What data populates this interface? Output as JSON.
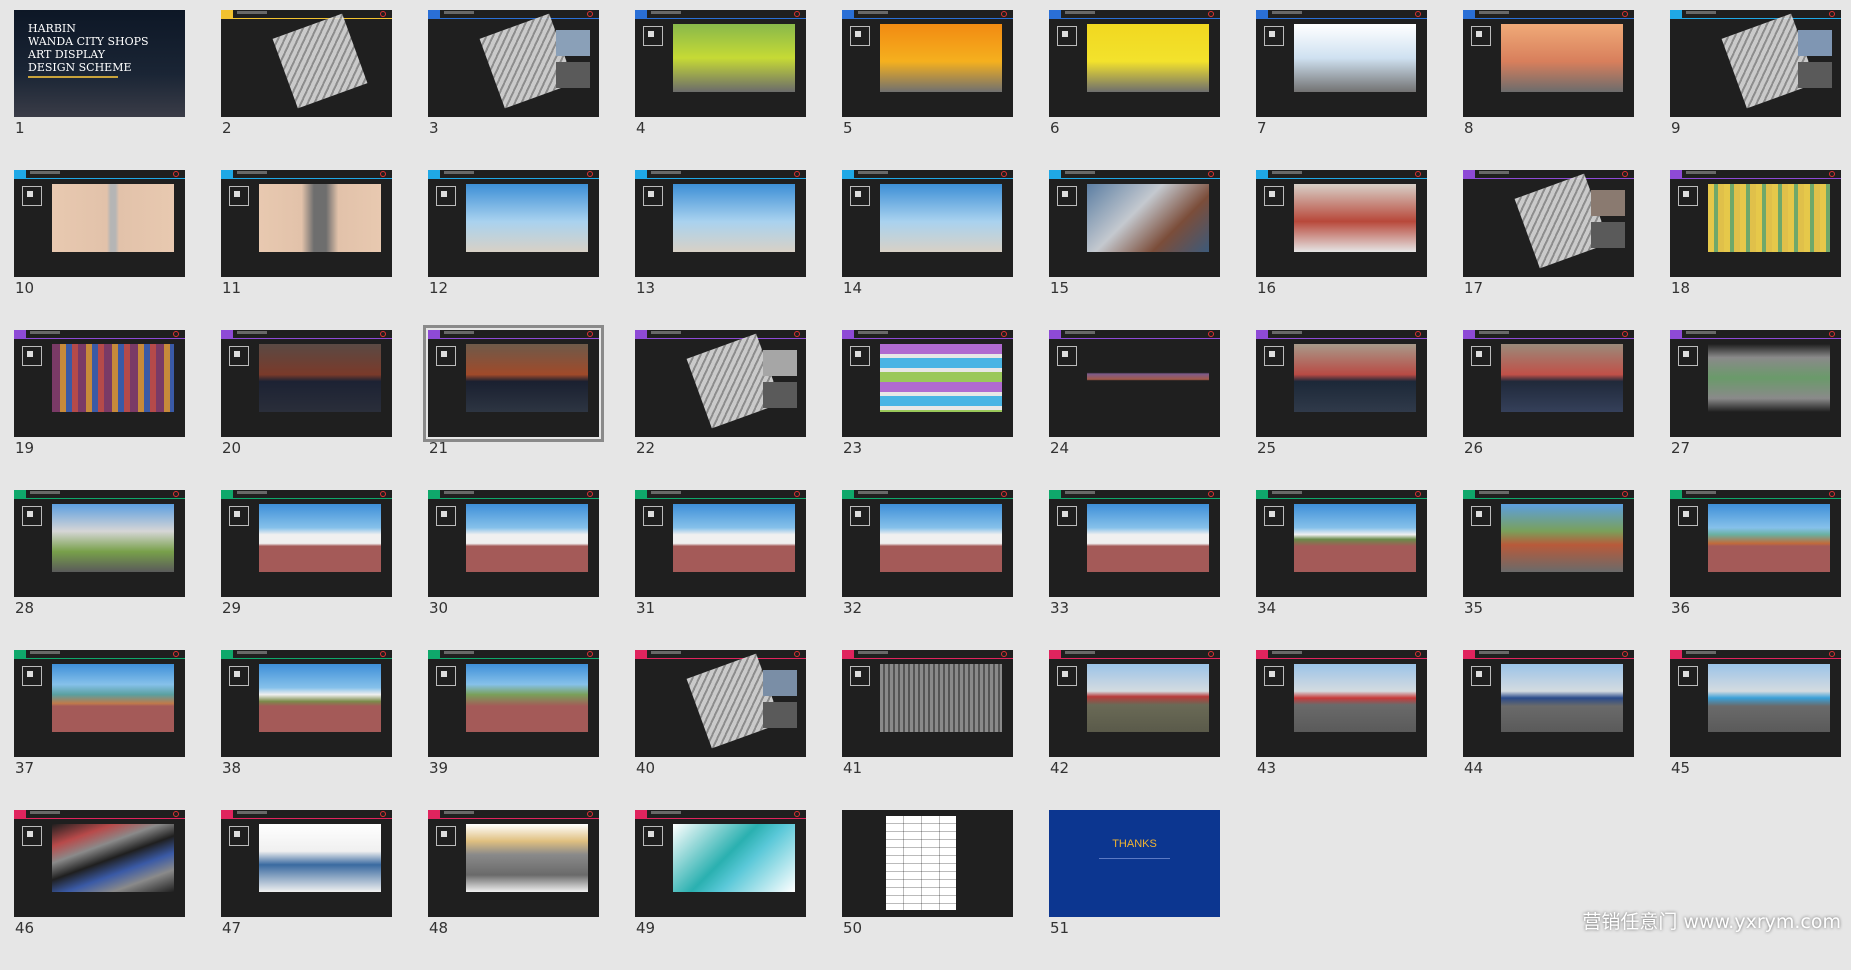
{
  "colors": {
    "background": "#e6e6e6",
    "slide_bg": "#1f1f1f",
    "cover_bg": "#0d1726",
    "thanks_bg": "#0c3690",
    "thanks_text": "#f2b530",
    "selected_outline": "#8a8a8a"
  },
  "cover": {
    "title": "HARBIN\nWANDA CITY SHOPS\nART DISPLAY\nDESIGN SCHEME"
  },
  "ending": {
    "title": "THANKS"
  },
  "selected_slide": 21,
  "watermark": "营销任意门 www.yxrym.com",
  "slides": [
    {
      "n": "1",
      "kind": "cover"
    },
    {
      "n": "2",
      "kind": "map",
      "accent": "#f2c230",
      "img": "#f4f4f4"
    },
    {
      "n": "3",
      "kind": "map-photo",
      "accent": "#2a6fd6",
      "img": "#8aa0b8"
    },
    {
      "n": "4",
      "kind": "photo",
      "accent": "#2a6fd6",
      "img": "linear-gradient(180deg,#89b94b 0%,#c6da35 50%,#6b6b6b 100%)"
    },
    {
      "n": "5",
      "kind": "photo",
      "accent": "#2a6fd6",
      "img": "linear-gradient(180deg,#f28a12 0%,#f5b01e 55%,#707070 100%)"
    },
    {
      "n": "6",
      "kind": "photo",
      "accent": "#2a6fd6",
      "img": "linear-gradient(180deg,#f1d820 0%,#f3e22c 55%,#6e6e6e 100%)"
    },
    {
      "n": "7",
      "kind": "photo",
      "accent": "#2a6fd6",
      "img": "linear-gradient(180deg,#ffffff 0%,#cfe1f1 50%,#727272 100%)"
    },
    {
      "n": "8",
      "kind": "photo",
      "accent": "#2a6fd6",
      "img": "linear-gradient(180deg,#f0aa78 0%,#d87f5c 55%,#6c6c6c 100%)"
    },
    {
      "n": "9",
      "kind": "map-photo",
      "accent": "#1fa8e6",
      "img": "#7f96b3"
    },
    {
      "n": "10",
      "kind": "photo",
      "accent": "#1fa8e6",
      "img": "linear-gradient(90deg,#e8c9b0 0%,#e2c2aa 45%,#b5b5b5 48%,#b5b5b5 52%,#e2c2aa 55%,#e8c9b0 100%)"
    },
    {
      "n": "11",
      "kind": "photo",
      "accent": "#1fa8e6",
      "img": "linear-gradient(90deg,#e8c9b0 0%,#e2c2aa 35%,#6e6e6e 45%,#6e6e6e 55%,#e2c2aa 65%,#e8c9b0 100%)"
    },
    {
      "n": "12",
      "kind": "photo",
      "accent": "#1fa8e6",
      "img": "linear-gradient(180deg,#3d8fd6 0%,#a9d2ef 55%,#d8d1c6 100%)"
    },
    {
      "n": "13",
      "kind": "photo",
      "accent": "#1fa8e6",
      "img": "linear-gradient(180deg,#3d8fd6 0%,#a9d2ef 55%,#d8d1c6 100%)"
    },
    {
      "n": "14",
      "kind": "photo",
      "accent": "#1fa8e6",
      "img": "linear-gradient(180deg,#3d8fd6 0%,#a9d2ef 55%,#d8d1c6 100%)"
    },
    {
      "n": "15",
      "kind": "photo",
      "accent": "#1fa8e6",
      "img": "linear-gradient(135deg,#5c7ea3 0%,#c4c9cf 40%,#7b4d3a 70%,#3c5a7a 100%)"
    },
    {
      "n": "16",
      "kind": "photo",
      "accent": "#1fa8e6",
      "img": "linear-gradient(180deg,#d8d0c8 0%,#b8483a 55%,#e5e5e5 100%)"
    },
    {
      "n": "17",
      "kind": "map-photo",
      "accent": "#8e4ad6",
      "img": "#8a7a70"
    },
    {
      "n": "18",
      "kind": "photo",
      "accent": "#8e4ad6",
      "img": "repeating-linear-gradient(90deg,#e6c84a 0 6px,#6fa86a 6px 10px,#e0c04a 10px 16px)"
    },
    {
      "n": "19",
      "kind": "photo",
      "accent": "#8e4ad6",
      "img": "repeating-linear-gradient(90deg,#7a3a66 0 8px,#c78a3a 8px 14px,#3a5aa6 14px 20px,#b54a4a 20px 26px)"
    },
    {
      "n": "20",
      "kind": "photo",
      "accent": "#8e4ad6",
      "img": "linear-gradient(180deg,#5a4a44 0%,#7a3a2a 45%,#1c2233 55%,#2a2e3a 100%)"
    },
    {
      "n": "21",
      "kind": "photo",
      "accent": "#8e4ad6",
      "img": "linear-gradient(180deg,#6e5a4a 0%,#a04a2a 45%,#1a2030 55%,#2d3542 100%)"
    },
    {
      "n": "22",
      "kind": "map-photo",
      "accent": "#8e4ad6",
      "img": "#a6a6a6"
    },
    {
      "n": "23",
      "kind": "photo",
      "accent": "#8e4ad6",
      "img": "repeating-linear-gradient(180deg,#b06ad0 0 10px,#e7e7e7 10px 14px,#48b4e4 14px 24px,#e7e7e7 24px 28px,#9ac85a 28px 38px)"
    },
    {
      "n": "24",
      "kind": "photo",
      "accent": "#8e4ad6",
      "img": "linear-gradient(180deg,#1f1f1f 0%,#1f1f1f 42%,#7c5a8a 44%,#a45a4a 52%,#1f1f1f 54%)"
    },
    {
      "n": "25",
      "kind": "photo",
      "accent": "#8e4ad6",
      "img": "linear-gradient(180deg,#a89a8a 0%,#b84a44 45%,#1c2838 55%,#303a4a 100%)"
    },
    {
      "n": "26",
      "kind": "photo",
      "accent": "#8e4ad6",
      "img": "linear-gradient(180deg,#9a8a7a 0%,#c05048 45%,#20293a 55%,#35405a 100%)"
    },
    {
      "n": "27",
      "kind": "photo",
      "accent": "#8e4ad6",
      "img": "linear-gradient(180deg,#1f1f1f 0%,#8a8a8a 20%,#6a9a6a 50%,#8a8a8a 80%,#1f1f1f 100%)"
    },
    {
      "n": "28",
      "kind": "photo",
      "accent": "#0fa86b",
      "img": "linear-gradient(180deg,#5c9fe0 0%,#d6d6d6 40%,#78a04a 70%,#5a5a5a 100%)"
    },
    {
      "n": "29",
      "kind": "photo",
      "accent": "#0fa86b",
      "img": "linear-gradient(180deg,#3e8fd8 0%,#86c1ea 35%,#f0f0f0 45%,#f0f0f0 58%,#a45a58 62%,#a45a58 100%)"
    },
    {
      "n": "30",
      "kind": "photo",
      "accent": "#0fa86b",
      "img": "linear-gradient(180deg,#3e8fd8 0%,#86c1ea 35%,#f0f0f0 45%,#f0f0f0 58%,#a45a58 62%,#a45a58 100%)"
    },
    {
      "n": "31",
      "kind": "photo",
      "accent": "#0fa86b",
      "img": "linear-gradient(180deg,#3e8fd8 0%,#86c1ea 35%,#f0f0f0 45%,#f0f0f0 58%,#a45a58 62%,#a45a58 100%)"
    },
    {
      "n": "32",
      "kind": "photo",
      "accent": "#0fa86b",
      "img": "linear-gradient(180deg,#3e8fd8 0%,#86c1ea 35%,#f0f0f0 45%,#f0f0f0 58%,#a45a58 62%,#a45a58 100%)"
    },
    {
      "n": "33",
      "kind": "photo",
      "accent": "#0fa86b",
      "img": "linear-gradient(180deg,#3e8fd8 0%,#86c1ea 35%,#f0f0f0 45%,#f0f0f0 58%,#a45a58 62%,#a45a58 100%)"
    },
    {
      "n": "34",
      "kind": "photo",
      "accent": "#0fa86b",
      "img": "linear-gradient(180deg,#3e8fd8 0%,#86c1ea 35%,#f0f0f0 45%,#6a8a4a 52%,#a45a58 62%,#a45a58 100%)"
    },
    {
      "n": "35",
      "kind": "photo",
      "accent": "#0fa86b",
      "img": "linear-gradient(180deg,#5c9fe0 0%,#7aa05a 40%,#b85a3a 60%,#6a6a6a 100%)"
    },
    {
      "n": "36",
      "kind": "photo",
      "accent": "#0fa86b",
      "img": "linear-gradient(180deg,#3e8fd8 0%,#86c1ea 35%,#6ab0a0 45%,#c26a3a 58%,#a45a58 62%,#a45a58 100%)"
    },
    {
      "n": "37",
      "kind": "photo",
      "accent": "#0fa86b",
      "img": "linear-gradient(180deg,#3e8fd8 0%,#86c1ea 30%,#5aa0a0 45%,#c07a4a 58%,#a45a58 62%,#a45a58 100%)"
    },
    {
      "n": "38",
      "kind": "photo",
      "accent": "#0fa86b",
      "img": "linear-gradient(180deg,#3e8fd8 0%,#86c1ea 35%,#f0f0f0 45%,#7a8a4a 55%,#a45a58 62%,#a45a58 100%)"
    },
    {
      "n": "39",
      "kind": "photo",
      "accent": "#0fa86b",
      "img": "linear-gradient(180deg,#3e8fd8 0%,#86c1ea 30%,#7aa05a 45%,#a45a58 62%,#a45a58 100%)"
    },
    {
      "n": "40",
      "kind": "map-photo",
      "accent": "#e0245e",
      "img": "#7a8ea6"
    },
    {
      "n": "41",
      "kind": "photo",
      "accent": "#e0245e",
      "img": "repeating-linear-gradient(90deg,#8a8a8a 0 3px,#555 3px 5px)"
    },
    {
      "n": "42",
      "kind": "photo",
      "accent": "#e0245e",
      "img": "linear-gradient(180deg,#9bc3e8 0%,#d4dbe0 40%,#b83a3a 48%,#6a6a56 60%,#5a5a4a 100%)"
    },
    {
      "n": "43",
      "kind": "photo",
      "accent": "#e0245e",
      "img": "linear-gradient(180deg,#9bc3e8 0%,#d4dbe0 40%,#c83a3a 50%,#6a6a6a 60%,#5a5a5a 100%)"
    },
    {
      "n": "44",
      "kind": "photo",
      "accent": "#e0245e",
      "img": "linear-gradient(180deg,#9bc3e8 0%,#d4dbe0 40%,#2a4a8a 50%,#6a6a6a 62%,#5a5a5a 100%)"
    },
    {
      "n": "45",
      "kind": "photo",
      "accent": "#e0245e",
      "img": "linear-gradient(180deg,#9bc3e8 0%,#d4dbe0 40%,#3aa0d8 50%,#6a6a6a 62%,#5a5a5a 100%)"
    },
    {
      "n": "46",
      "kind": "photo",
      "accent": "#e0245e",
      "img": "linear-gradient(160deg,#1f1f1f 0%,#b84a4a 20%,#8a8a8a 35%,#1f1f1f 50%,#3a5aa6 65%,#8a8a8a 80%,#1f1f1f 100%)"
    },
    {
      "n": "47",
      "kind": "photo",
      "accent": "#e0245e",
      "img": "linear-gradient(180deg,#ffffff 0%,#f0f0f0 40%,#3a6aa0 60%,#f0f0f0 100%)"
    },
    {
      "n": "48",
      "kind": "photo",
      "accent": "#e0245e",
      "img": "linear-gradient(180deg,#ffffff 0%,#e0c080 25%,#8a8a8a 45%,#6a6a6a 75%,#f0f0f0 100%)"
    },
    {
      "n": "49",
      "kind": "photo",
      "accent": "#e0245e",
      "img": "linear-gradient(135deg,#ffffff 0%,#2ab0b0 45%,#5ac8d8 60%,#ffffff 100%)"
    },
    {
      "n": "50",
      "kind": "table"
    },
    {
      "n": "51",
      "kind": "thanks"
    }
  ]
}
